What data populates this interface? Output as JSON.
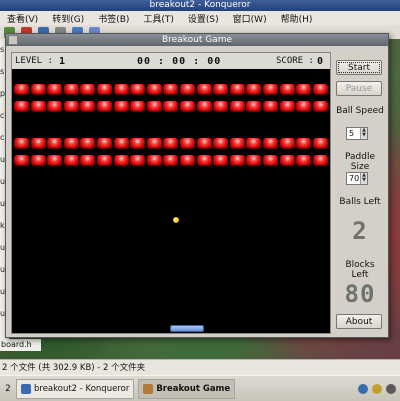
{
  "konqueror": {
    "title": "breakout2 - Konqueror",
    "menu": [
      "查看(V)",
      "转到(G)",
      "书签(B)",
      "工具(T)",
      "设置(S)",
      "窗口(W)",
      "帮助(H)"
    ],
    "sidebar_chars": [
      "s",
      "s",
      "pi",
      "ce",
      "cp",
      "ut",
      "ut",
      "ut",
      "k",
      "ut",
      "ut",
      "ut",
      "ut"
    ],
    "visible_file": "board.h",
    "status": "2 个文件 (共 302.9 KB) - 2 个文件夹"
  },
  "taskbar": {
    "desktop_number": "2",
    "tasks": [
      {
        "label": "breakout2 - Konqueror",
        "active": false
      },
      {
        "label": "Breakout Game",
        "active": true
      }
    ]
  },
  "game": {
    "window_title": "Breakout Game",
    "level_label": "LEVEL :",
    "level_value": "1",
    "timer": "00 : 00 : 00",
    "score_label": "SCORE :",
    "score_value": "0",
    "brick_rows": 4,
    "brick_columns": 19,
    "start_label": "Start",
    "pause_label": "Pause",
    "ball_speed_label": "Ball Speed",
    "ball_speed_value": "5",
    "paddle_size_label": "Paddle Size",
    "paddle_size_value": "70",
    "balls_left_label": "Balls Left",
    "balls_left_value": "2",
    "blocks_left_label": "Blocks Left",
    "blocks_left_value": "80",
    "about_label": "About"
  },
  "colors": {
    "brick": "#d40000",
    "ball": "#f2c000",
    "paddle": "#7a9fdf",
    "playfield": "#000000"
  }
}
